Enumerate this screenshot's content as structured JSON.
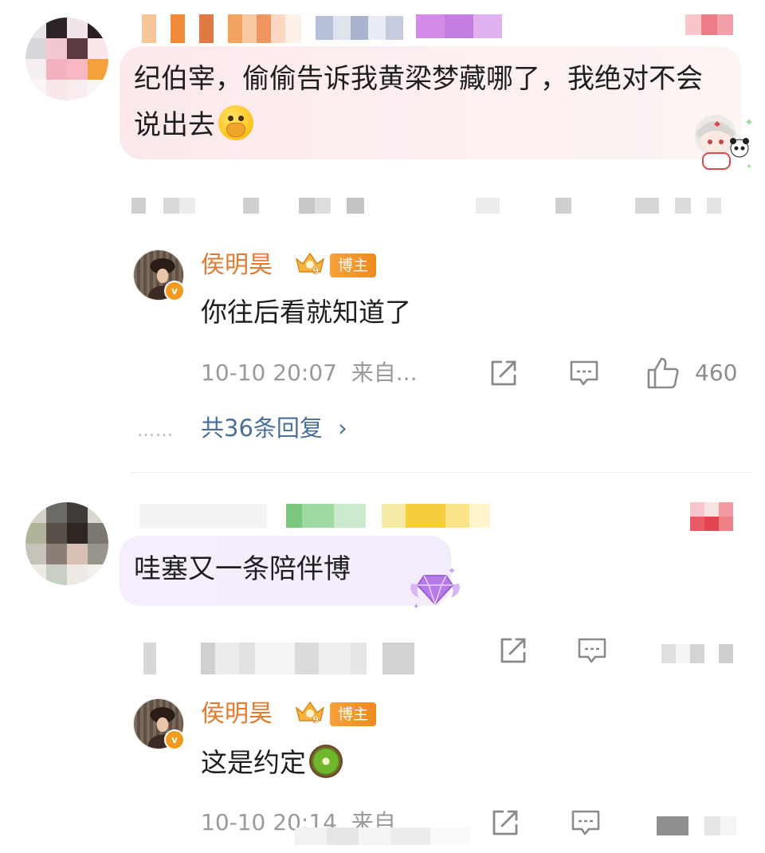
{
  "comment1": {
    "text": "纪伯宰，偷偷告诉我黄梁梦藏哪了，我绝对不会说出去",
    "emoji": "shushing-face-icon"
  },
  "reply1": {
    "username": "侯明昊",
    "vip_level": "9",
    "badge": "博主",
    "text": "你往后看就知道了",
    "time": "10-10 20:07",
    "source": "来自...",
    "likes": "460",
    "more_replies": "共36条回复",
    "more_dots": "……"
  },
  "comment2": {
    "text": "哇塞又一条陪伴博"
  },
  "reply2": {
    "username": "侯明昊",
    "vip_level": "9",
    "badge": "博主",
    "text": "这是约定",
    "emoji": "kiwi-fruit-icon",
    "time": "10-10 20:14",
    "source": "来自"
  },
  "colors": {
    "username": "#e5792d",
    "link": "#4a6f9a",
    "meta": "#9a9a9a",
    "badge": "#f08a1f"
  }
}
